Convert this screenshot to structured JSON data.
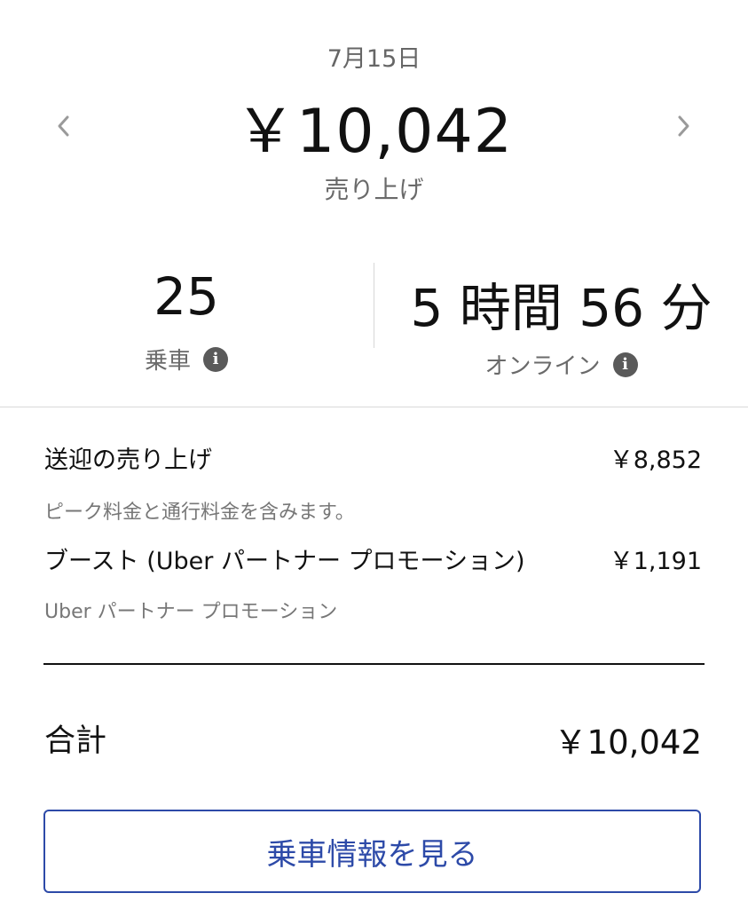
{
  "header": {
    "date": "7月15日",
    "amount": "￥10,042",
    "label": "売り上げ"
  },
  "stats": {
    "trips": {
      "value": "25",
      "label": "乗車"
    },
    "online": {
      "value": "5 時間 56 分",
      "label": "オンライン"
    }
  },
  "breakdown": {
    "items": [
      {
        "label": "送迎の売り上げ",
        "value": "￥8,852",
        "note": "ピーク料金と通行料金を含みます。"
      },
      {
        "label": "ブースト (Uber パートナー プロモーション)",
        "value": "￥1,191",
        "note": "Uber パートナー プロモーション"
      }
    ],
    "total": {
      "label": "合計",
      "value": "￥10,042"
    }
  },
  "actions": {
    "view_trips": "乗車情報を見る"
  },
  "colors": {
    "accent": "#2d4aa8",
    "text": "#111111",
    "muted": "#6a6a6a",
    "divider": "#d9d9d9"
  },
  "icons": [
    "chevron-left-icon",
    "chevron-right-icon",
    "info-icon"
  ]
}
